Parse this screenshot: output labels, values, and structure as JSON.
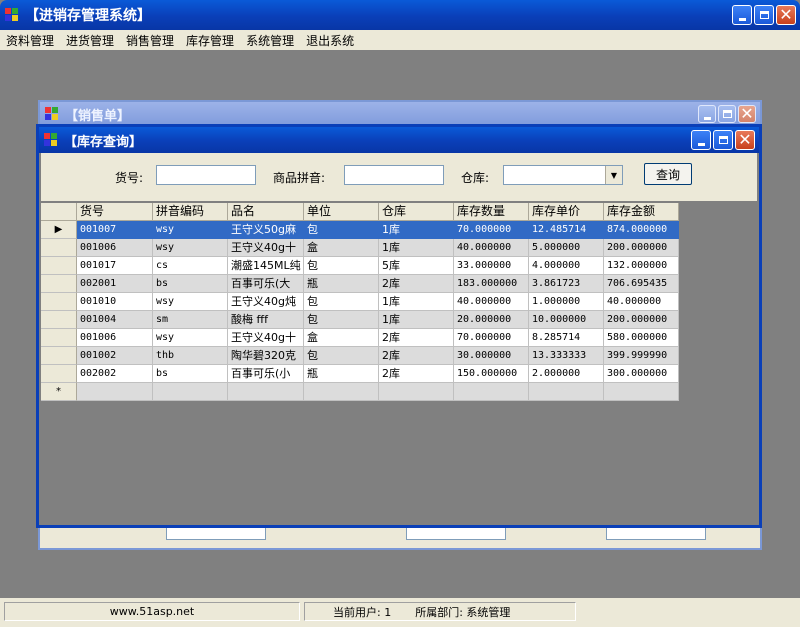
{
  "app": {
    "title": "【进销存管理系统】"
  },
  "menu": {
    "items": [
      "资料管理",
      "进货管理",
      "销售管理",
      "库存管理",
      "系统管理",
      "退出系统"
    ]
  },
  "sales_window": {
    "title": "【销售单】"
  },
  "inventory_window": {
    "title": "【库存查询】",
    "query": {
      "item_no_label": "货号:",
      "pinyin_label": "商品拼音:",
      "warehouse_label": "仓库:",
      "item_no_value": "",
      "pinyin_value": "",
      "warehouse_value": "",
      "query_button": "查询"
    },
    "grid": {
      "columns": [
        "货号",
        "拼音编码",
        "品名",
        "单位",
        "仓库",
        "库存数量",
        "库存单价",
        "库存金额"
      ],
      "rows": [
        [
          "001007",
          "wsy",
          "王守义50g麻",
          "包",
          "1库",
          "70.000000",
          "12.485714",
          "874.000000"
        ],
        [
          "001006",
          "wsy",
          "王守义40g十",
          "盒",
          "1库",
          "40.000000",
          "5.000000",
          "200.000000"
        ],
        [
          "001017",
          "cs",
          "潮盛145ML纯",
          "包",
          "5库",
          "33.000000",
          "4.000000",
          "132.000000"
        ],
        [
          "002001",
          "bs",
          "百事可乐(大",
          "瓶",
          "2库",
          "183.000000",
          "3.861723",
          "706.695435"
        ],
        [
          "001010",
          "wsy",
          "王守义40g炖",
          "包",
          "1库",
          "40.000000",
          "1.000000",
          "40.000000"
        ],
        [
          "001004",
          "sm",
          "酸梅 fff",
          "包",
          "1库",
          "20.000000",
          "10.000000",
          "200.000000"
        ],
        [
          "001006",
          "wsy",
          "王守义40g十",
          "盒",
          "2库",
          "70.000000",
          "8.285714",
          "580.000000"
        ],
        [
          "001002",
          "thb",
          "陶华碧320克",
          "包",
          "2库",
          "30.000000",
          "13.333333",
          "399.999990"
        ],
        [
          "002002",
          "bs",
          "百事可乐(小",
          "瓶",
          "2库",
          "150.000000",
          "2.000000",
          "300.000000"
        ]
      ],
      "selected_row_marker": "▶",
      "new_row_marker": "*"
    }
  },
  "statusbar": {
    "website": "www.51asp.net",
    "current_user": "当前用户: 1",
    "department": "所属部门: 系统管理"
  }
}
